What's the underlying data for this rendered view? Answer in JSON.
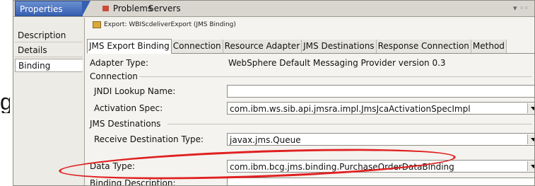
{
  "left_edge_text": "g",
  "view_tabs": {
    "active": "Properties",
    "inactive": [
      "Problems",
      "Servers"
    ]
  },
  "sidebar": {
    "items": [
      "Description",
      "Details",
      "Binding"
    ],
    "selected": "Binding"
  },
  "export_header": "Export: WBIScdeliverExport (JMS Binding)",
  "content_tabs": [
    "JMS Export Binding",
    "Connection",
    "Resource Adapter",
    "JMS Destinations",
    "Response Connection",
    "Method"
  ],
  "form": {
    "adapter_type_label": "Adapter Type:",
    "adapter_type_value": "WebSphere Default Messaging Provider version 0.3",
    "connection_section": "Connection",
    "jndi_lookup_label": "JNDI Lookup Name:",
    "jndi_lookup_value": "",
    "activation_spec_label": "Activation Spec:",
    "activation_spec_value": "com.ibm.ws.sib.api.jmsra.impl.JmsJcaActivationSpecImpl",
    "jms_destinations_section": "JMS Destinations",
    "receive_destination_label": "Receive Destination Type:",
    "receive_destination_value": "javax.jms.Queue",
    "data_type_label": "Data Type:",
    "data_type_value": "com.ibm.bcg.jms.binding.PurchaseOrderDataBinding",
    "binding_description_label": "Binding Description:",
    "binding_description_value": ""
  },
  "annotation_color": "#e02020"
}
